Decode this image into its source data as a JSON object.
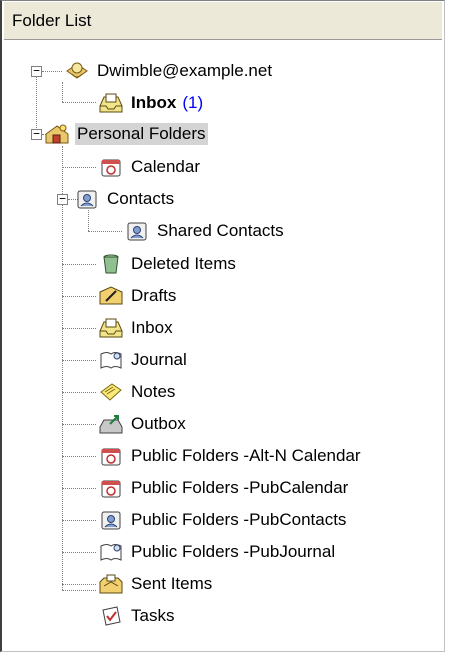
{
  "header": {
    "title": "Folder List"
  },
  "account": {
    "label": "Dwimble@example.net",
    "toggle": "−"
  },
  "account_inbox": {
    "label": "Inbox",
    "count": "(1)"
  },
  "personal": {
    "label": "Personal Folders",
    "toggle": "−"
  },
  "folders": {
    "calendar": "Calendar",
    "contacts": "Contacts",
    "contacts_toggle": "−",
    "shared_contacts": "Shared Contacts",
    "deleted_items": "Deleted Items",
    "drafts": "Drafts",
    "inbox": "Inbox",
    "journal": "Journal",
    "notes": "Notes",
    "outbox": "Outbox",
    "public_altn_calendar": "Public Folders -Alt-N Calendar",
    "public_pubcalendar": "Public Folders -PubCalendar",
    "public_pubcontacts": "Public Folders -PubContacts",
    "public_pubjournal": "Public Folders -PubJournal",
    "sent_items": "Sent Items",
    "tasks": "Tasks"
  }
}
